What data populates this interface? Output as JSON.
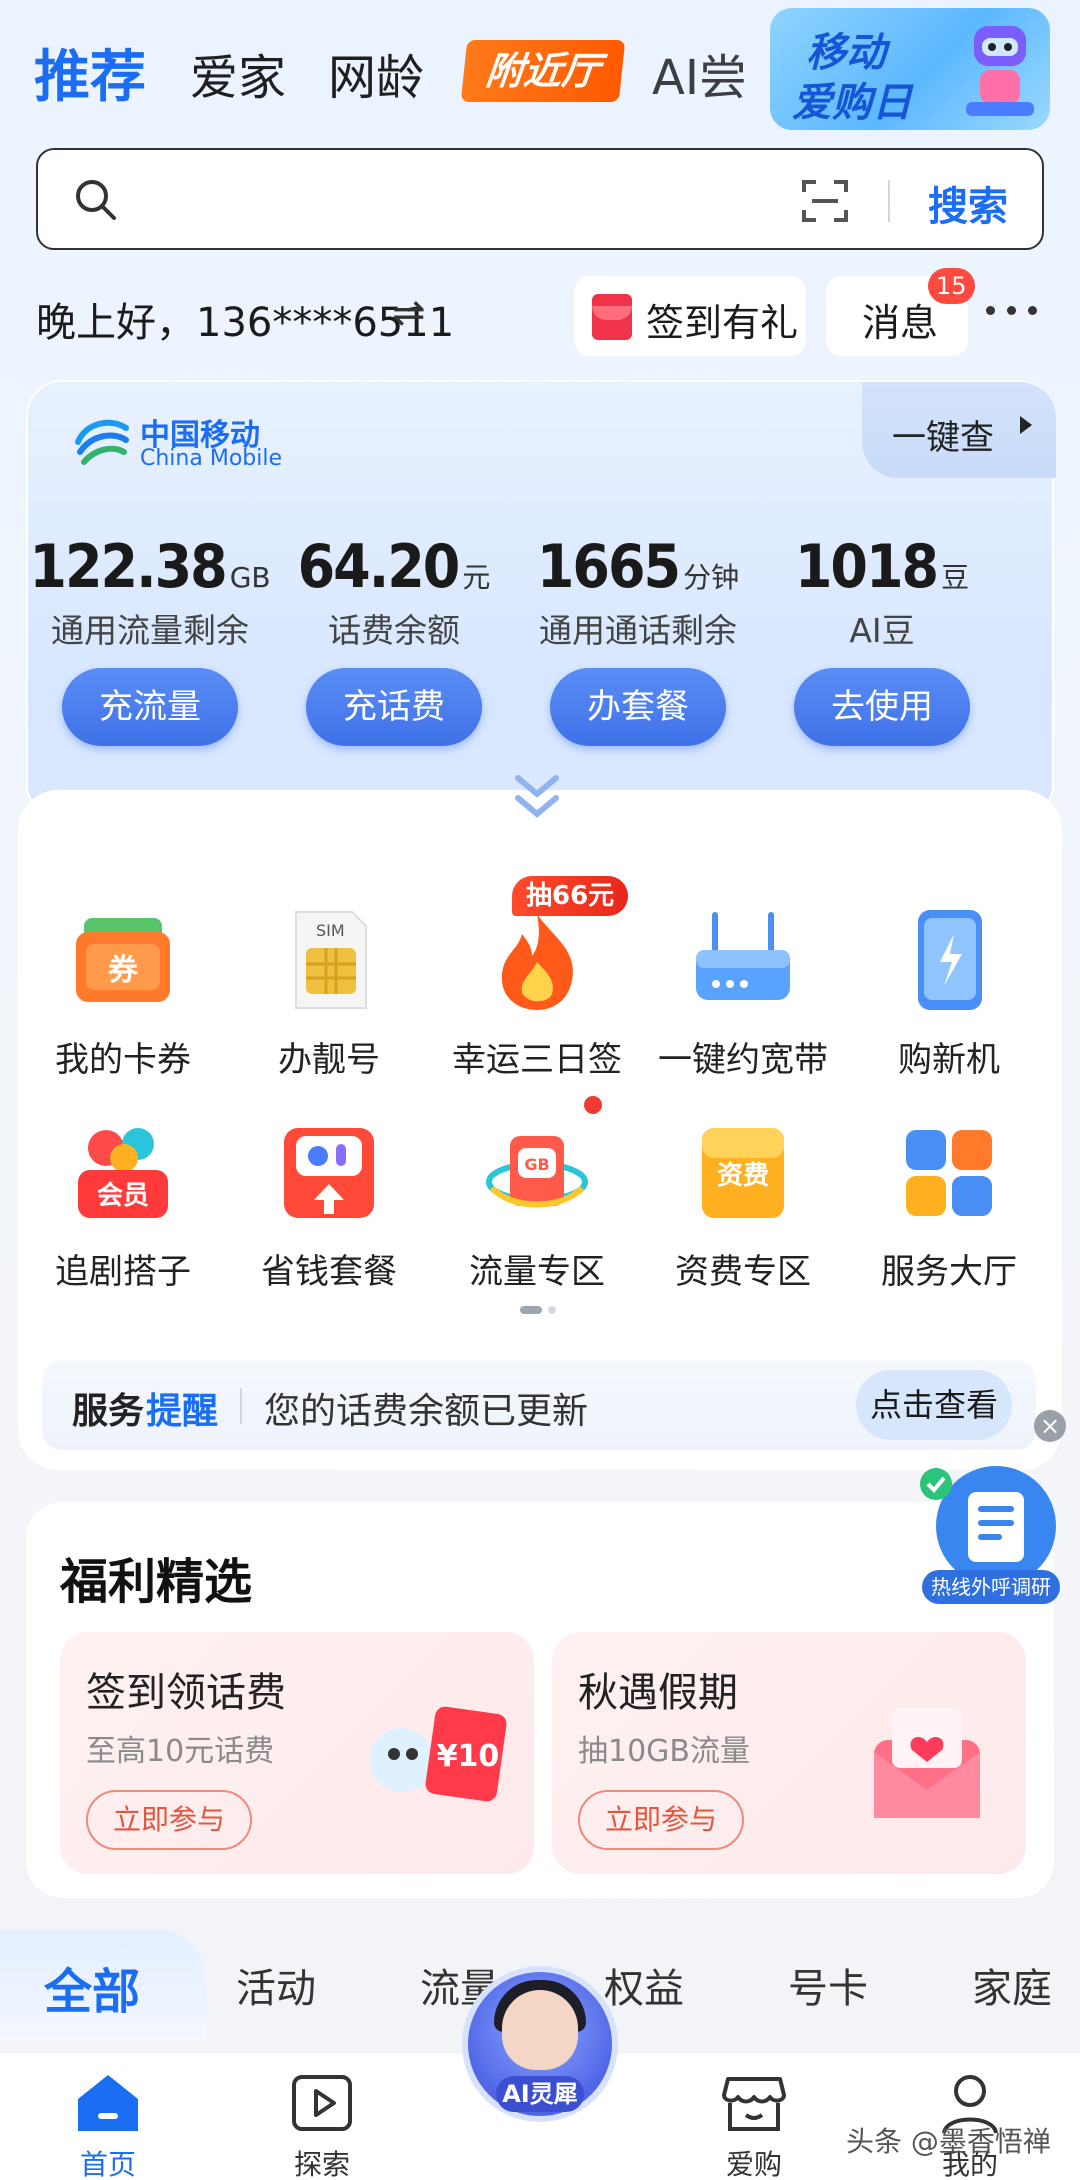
{
  "top_tabs": [
    {
      "label": "推荐",
      "active": true
    },
    {
      "label": "爱家"
    },
    {
      "label": "网龄"
    },
    {
      "label": "附近厅",
      "highlight": true
    },
    {
      "label": "AI尝"
    }
  ],
  "promo": {
    "line1": "移动",
    "line2": "爱购日"
  },
  "search": {
    "placeholder": "",
    "button": "搜索"
  },
  "greeting": {
    "text": "晚上好，136****6511",
    "swap_icon": "⇌"
  },
  "signin": {
    "label": "签到有礼"
  },
  "messages": {
    "label": "消息",
    "count": "15"
  },
  "account": {
    "brand_cn": "中国移动",
    "brand_en": "China Mobile",
    "quick_check": "一键查",
    "stats": [
      {
        "value": "122.38",
        "unit": "GB",
        "label": "通用流量剩余",
        "button": "充流量"
      },
      {
        "value": "64.20",
        "unit": "元",
        "label": "话费余额",
        "button": "充话费"
      },
      {
        "value": "1665",
        "unit": "分钟",
        "label": "通用通话剩余",
        "button": "办套餐"
      },
      {
        "value": "1018",
        "unit": "豆",
        "label": "AI豆",
        "button": "去使用"
      }
    ]
  },
  "services": {
    "hot_tag": "抽66元",
    "items": [
      {
        "label": "我的卡券",
        "icon": "coupon-icon"
      },
      {
        "label": "办靓号",
        "icon": "sim-card-icon"
      },
      {
        "label": "幸运三日签",
        "icon": "flame-icon"
      },
      {
        "label": "一键约宽带",
        "icon": "router-icon"
      },
      {
        "label": "购新机",
        "icon": "phone-icon"
      },
      {
        "label": "追剧搭子",
        "icon": "member-icon"
      },
      {
        "label": "省钱套餐",
        "icon": "savings-icon"
      },
      {
        "label": "流量专区",
        "icon": "data-gb-icon"
      },
      {
        "label": "资费专区",
        "icon": "tariff-icon"
      },
      {
        "label": "服务大厅",
        "icon": "grid-apps-icon"
      }
    ]
  },
  "reminder": {
    "title_a": "服务",
    "title_b": "提醒",
    "text": "您的话费余额已更新",
    "button": "点击查看"
  },
  "survey": {
    "label": "热线外呼调研"
  },
  "welfare": {
    "title": "福利精选",
    "cards": [
      {
        "title": "签到领话费",
        "subtitle": "至高10元话费",
        "button": "立即参与",
        "tag": "¥10"
      },
      {
        "title": "秋遇假期",
        "subtitle": "抽10GB流量",
        "button": "立即参与"
      }
    ]
  },
  "filters": [
    {
      "label": "全部",
      "active": true
    },
    {
      "label": "活动"
    },
    {
      "label": "流量"
    },
    {
      "label": "权益"
    },
    {
      "label": "号卡"
    },
    {
      "label": "家庭"
    }
  ],
  "bottom_nav": [
    {
      "label": "首页",
      "active": true
    },
    {
      "label": "探索"
    },
    {
      "label": "AI灵犀"
    },
    {
      "label": "爱购"
    },
    {
      "label": "我的"
    }
  ],
  "watermark": "头条 @墨香悟禅",
  "colors": {
    "brand_blue": "#1b6ef3",
    "orange": "#ff6a10",
    "badge_red": "#ff4a40"
  }
}
